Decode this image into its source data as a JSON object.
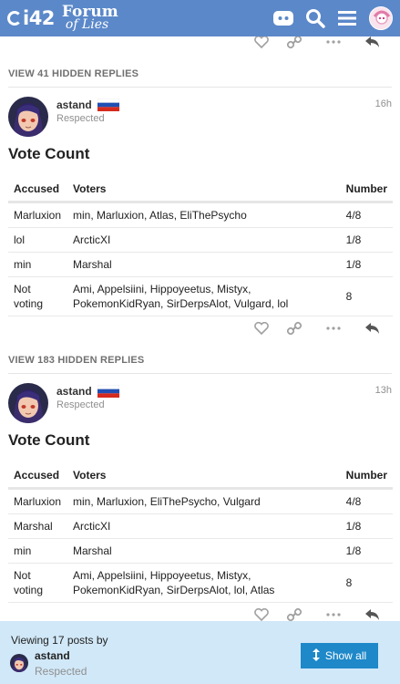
{
  "header": {
    "logo_short": "i42",
    "logo_line1": "Forum",
    "logo_line2": "of Lies",
    "icons": [
      "discord-icon",
      "search-icon",
      "hamburger-menu-icon",
      "user-avatar"
    ]
  },
  "hidden_replies": [
    {
      "label": "VIEW 41 HIDDEN REPLIES"
    },
    {
      "label": "VIEW 183 HIDDEN REPLIES"
    }
  ],
  "posts": [
    {
      "username": "astand",
      "role": "Respected",
      "time": "16h",
      "heading": "Vote Count",
      "columns": [
        "Accused",
        "Voters",
        "Number"
      ],
      "rows": [
        {
          "accused": "Marluxion",
          "voters": "min, Marluxion, Atlas, EliThePsycho",
          "number": "4/8"
        },
        {
          "accused": "lol",
          "voters": "ArcticXI",
          "number": "1/8"
        },
        {
          "accused": "min",
          "voters": "Marshal",
          "number": "1/8"
        },
        {
          "accused": "Not voting",
          "voters": "Ami, Appelsiini, Hippoyeetus, Mistyx, PokemonKidRyan, SirDerpsAlot, Vulgard, lol",
          "number": "8"
        }
      ]
    },
    {
      "username": "astand",
      "role": "Respected",
      "time": "13h",
      "heading": "Vote Count",
      "columns": [
        "Accused",
        "Voters",
        "Number"
      ],
      "rows": [
        {
          "accused": "Marluxion",
          "voters": "min, Marluxion, EliThePsycho, Vulgard",
          "number": "4/8"
        },
        {
          "accused": "Marshal",
          "voters": "ArcticXI",
          "number": "1/8"
        },
        {
          "accused": "min",
          "voters": "Marshal",
          "number": "1/8"
        },
        {
          "accused": "Not voting",
          "voters": "Ami, Appelsiini, Hippoyeetus, Mistyx, PokemonKidRyan, SirDerpsAlot, lol, Atlas",
          "number": "8"
        }
      ]
    }
  ],
  "post_actions": [
    "like-icon",
    "link-icon",
    "more-icon",
    "reply-icon"
  ],
  "bottom_bar": {
    "title": "Viewing 17 posts by",
    "username": "astand",
    "role": "Respected",
    "button_label": "Show all"
  },
  "colors": {
    "header_bg": "#5b88c9",
    "bottom_bg": "#d1e8f8",
    "button_bg": "#1e88c9"
  }
}
